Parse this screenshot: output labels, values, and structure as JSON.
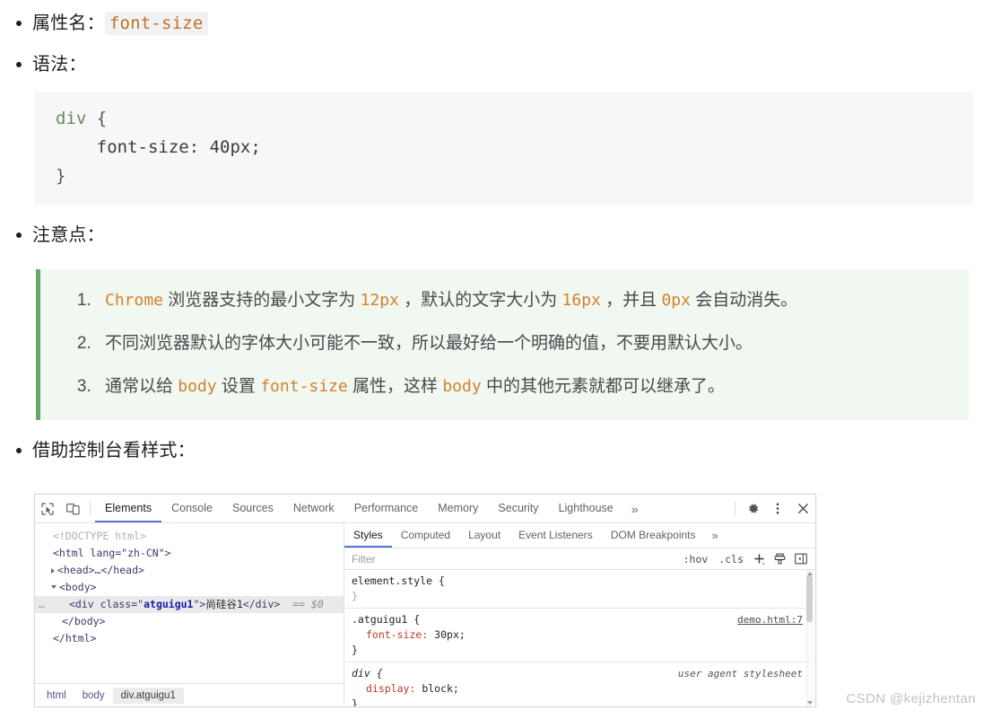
{
  "bullets": {
    "prop_label": "属性名：",
    "prop_code": "font-size",
    "syntax_label": "语法：",
    "notes_label": "注意点：",
    "devtools_label": "借助控制台看样式："
  },
  "code_block": {
    "line1_sel": "div",
    "line1_brace": " {",
    "line2": "    font-size: 40px;",
    "line3": "}"
  },
  "notes": [
    {
      "num": "1.",
      "parts": [
        {
          "t": "Chrome",
          "code": true
        },
        {
          "t": " 浏览器支持的最小文字为 ",
          "code": false
        },
        {
          "t": "12px",
          "code": true
        },
        {
          "t": " ，默认的文字大小为 ",
          "code": false
        },
        {
          "t": "16px",
          "code": true
        },
        {
          "t": " ，并且 ",
          "code": false
        },
        {
          "t": "0px",
          "code": true
        },
        {
          "t": " 会自动消失。",
          "code": false
        }
      ]
    },
    {
      "num": "2.",
      "parts": [
        {
          "t": "不同浏览器默认的字体大小可能不一致，所以最好给一个明确的值，不要用默认大小。",
          "code": false
        }
      ]
    },
    {
      "num": "3.",
      "parts": [
        {
          "t": "通常以给 ",
          "code": false
        },
        {
          "t": "body",
          "code": true
        },
        {
          "t": " 设置 ",
          "code": false
        },
        {
          "t": "font-size",
          "code": true
        },
        {
          "t": " 属性，这样 ",
          "code": false
        },
        {
          "t": "body",
          "code": true
        },
        {
          "t": " 中的其他元素就都可以继承了。",
          "code": false
        }
      ]
    }
  ],
  "devtools": {
    "toolbar": {
      "inspect_icon": "inspect-cursor-icon",
      "device_icon": "device-toolbar-icon",
      "tabs": [
        {
          "label": "Elements",
          "active": true
        },
        {
          "label": "Console",
          "active": false
        },
        {
          "label": "Sources",
          "active": false
        },
        {
          "label": "Network",
          "active": false
        },
        {
          "label": "Performance",
          "active": false
        },
        {
          "label": "Memory",
          "active": false
        },
        {
          "label": "Security",
          "active": false
        },
        {
          "label": "Lighthouse",
          "active": false
        }
      ],
      "overflow": "»",
      "settings_icon": "gear-icon",
      "menu_icon": "kebab-menu-icon",
      "close_icon": "close-icon"
    },
    "dom": {
      "doctype": "<!DOCTYPE html>",
      "html_open": "<html lang=\"zh-CN\">",
      "html_lang_attr": "zh-CN",
      "head_line": "<head>…</head>",
      "body_open": "<body>",
      "div_open": "<div class=\"",
      "div_class": "atguigu1",
      "div_mid": "\">",
      "div_text": "尚硅谷1",
      "div_close": "</div>",
      "selected_marker": "== $0",
      "body_close": "</body>",
      "html_close": "</html>",
      "row_dots": "…"
    },
    "breadcrumb": [
      {
        "label": "html",
        "active": false
      },
      {
        "label": "body",
        "active": false
      },
      {
        "label": "div.atguigu1",
        "active": true
      }
    ],
    "styles": {
      "tabs": [
        {
          "label": "Styles",
          "active": true
        },
        {
          "label": "Computed",
          "active": false
        },
        {
          "label": "Layout",
          "active": false
        },
        {
          "label": "Event Listeners",
          "active": false
        },
        {
          "label": "DOM Breakpoints",
          "active": false
        }
      ],
      "overflow": "»",
      "filter_placeholder": "Filter",
      "filter_value": "",
      "hov_label": ":hov",
      "cls_label": ".cls",
      "plus_label": "+",
      "print_icon": "print-style-icon",
      "sidebar_icon": "toggle-sidebar-icon",
      "rules": [
        {
          "selector": "element.style {",
          "close": "}",
          "muted": true,
          "origin": "",
          "declarations": []
        },
        {
          "selector": ".atguigu1 {",
          "close": "}",
          "muted": false,
          "origin": "demo.html:7",
          "origin_ua": false,
          "declarations": [
            {
              "prop": "font-size",
              "value": " 30px;"
            }
          ]
        },
        {
          "selector": "div {",
          "close": "}",
          "muted": false,
          "italic": true,
          "origin": "user agent stylesheet",
          "origin_ua": true,
          "declarations": [
            {
              "prop": "display",
              "value": " block;"
            }
          ]
        }
      ]
    }
  },
  "watermark": "CSDN @kejizhentan",
  "colors": {
    "code_orange": "#c0702a",
    "note_border_green": "#67a86a",
    "note_bg": "#f1f7f1",
    "devtools_accent": "#5b72d6",
    "selector_green": "#6a8759",
    "prop_red": "#c0392b"
  }
}
